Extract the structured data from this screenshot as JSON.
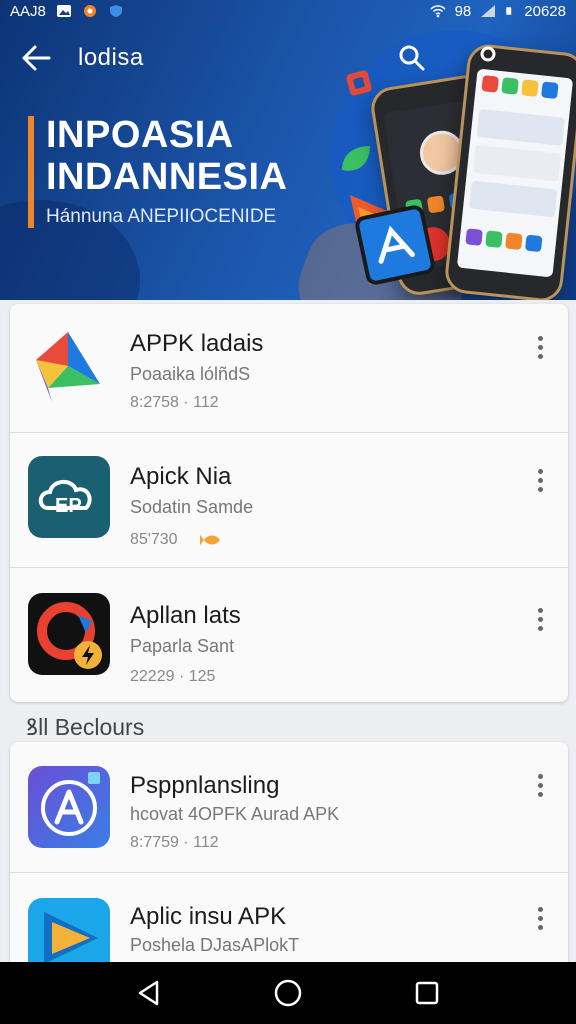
{
  "status_bar": {
    "left_text": "AAJ8",
    "signal_text": "98",
    "time": "20628",
    "icons": [
      "photo-icon",
      "app-notification-icon",
      "shield-icon",
      "wifi-icon",
      "signal-icon",
      "battery-icon"
    ]
  },
  "header": {
    "title": "lodisa",
    "back_icon": "arrow-left-icon",
    "search_icon": "search-icon",
    "profile_icon": "profile-icon"
  },
  "hero": {
    "title_line1": "INPOASIA",
    "title_line2": "INDANNESIA",
    "subtitle": "Hánnuna ANEPIIOCENIDE",
    "accent_color": "#f0862a"
  },
  "apps_top": [
    {
      "name": "APPK ladais",
      "subtitle": "Poaaika lólñdS",
      "meta": "8:2758 · 112",
      "icon": "prism-triangle-icon"
    },
    {
      "name": "Apick Nia",
      "subtitle": "Sodatin Samde",
      "meta": "85'730",
      "badge_icon": "fish-icon",
      "icon": "cloud-ep-icon"
    },
    {
      "name": "Apllan lats",
      "subtitle": "Paparla Sant",
      "meta": "22229 · 125",
      "icon": "ring-bolt-icon"
    }
  ],
  "section": {
    "title": "ꝸll Beclours"
  },
  "apps_bottom": [
    {
      "name": "Psppnlansling",
      "subtitle": "hcovat 4OPFK Aurad APK",
      "meta": "8:7759 · 112",
      "icon": "letter-a-icon"
    },
    {
      "name": "Aplic insu APK",
      "subtitle": "Poshela DJasAPlokT",
      "meta": "",
      "icon": "play-triangle-icon"
    }
  ],
  "nav": {
    "back_icon": "triangle-back-icon",
    "home_icon": "circle-home-icon",
    "recents_icon": "square-recents-icon"
  }
}
